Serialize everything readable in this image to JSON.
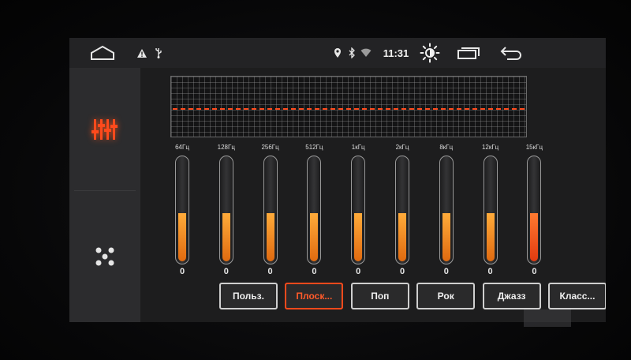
{
  "status_bar": {
    "time": "11:31",
    "icons": [
      "home-icon",
      "warning-icon",
      "usb-icon",
      "location-icon",
      "bluetooth-icon",
      "wifi-icon",
      "brightness-icon",
      "recent-apps-icon",
      "back-icon"
    ]
  },
  "sidebar": {
    "tabs": [
      {
        "name": "equalizer",
        "icon": "equalizer-icon",
        "active": true
      },
      {
        "name": "sound-field",
        "icon": "sound-field-icon",
        "active": false
      }
    ]
  },
  "equalizer": {
    "bands": [
      {
        "freq": "64Гц",
        "value": "0",
        "level": 0.47
      },
      {
        "freq": "128Гц",
        "value": "0",
        "level": 0.47
      },
      {
        "freq": "256Гц",
        "value": "0",
        "level": 0.47
      },
      {
        "freq": "512Гц",
        "value": "0",
        "level": 0.47
      },
      {
        "freq": "1кГц",
        "value": "0",
        "level": 0.47
      },
      {
        "freq": "2кГц",
        "value": "0",
        "level": 0.47
      },
      {
        "freq": "8кГц",
        "value": "0",
        "level": 0.47
      },
      {
        "freq": "12кГц",
        "value": "0",
        "level": 0.47
      },
      {
        "freq": "15кГц",
        "value": "0",
        "level": 0.47
      }
    ],
    "presets": [
      {
        "label": "Польз.",
        "active": false
      },
      {
        "label": "Плоск...",
        "active": true
      },
      {
        "label": "Поп",
        "active": false
      },
      {
        "label": "Рок",
        "active": false
      },
      {
        "label": "Джазз",
        "active": false
      },
      {
        "label": "Класс...",
        "active": false
      }
    ]
  },
  "colors": {
    "accent": "#ff4a1c",
    "fill_top": "#ffab3a",
    "fill_bottom": "#e06a10",
    "last_fill_top": "#ff7a30",
    "last_fill_bottom": "#e23a10"
  }
}
